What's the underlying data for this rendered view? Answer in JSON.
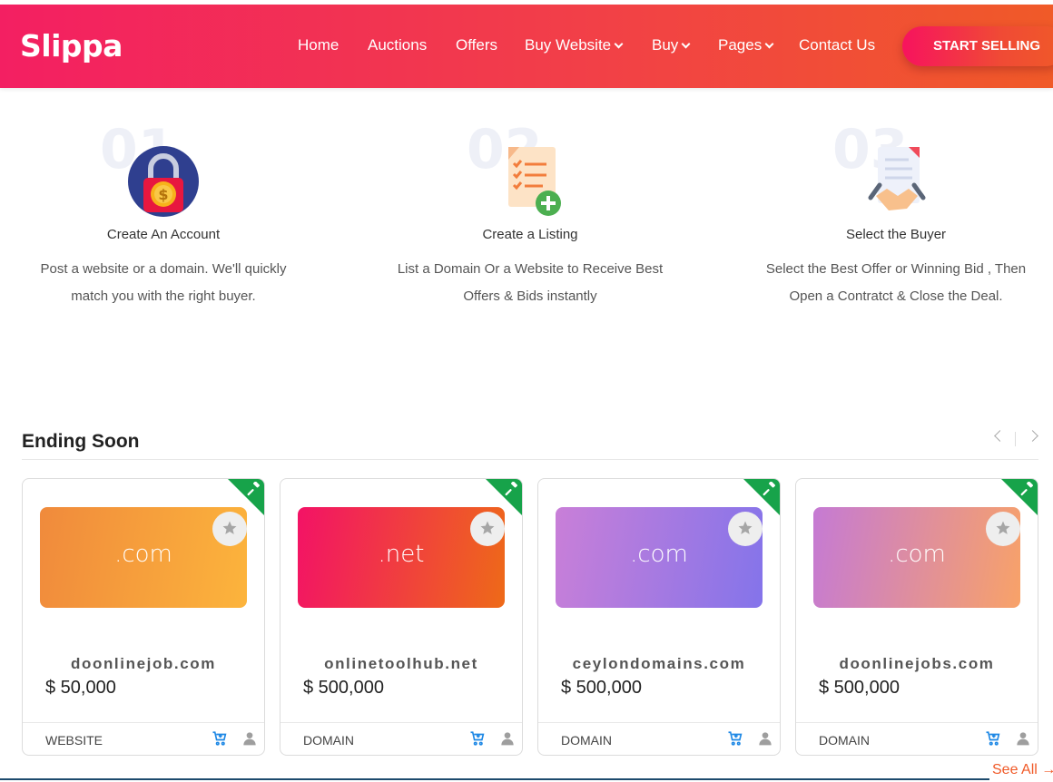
{
  "brand": {
    "name": "Slippa"
  },
  "nav": {
    "items": [
      {
        "label": "Home",
        "dropdown": false
      },
      {
        "label": "Auctions",
        "dropdown": false
      },
      {
        "label": "Offers",
        "dropdown": false
      },
      {
        "label": "Buy Website",
        "dropdown": true
      },
      {
        "label": "Buy",
        "dropdown": true
      },
      {
        "label": "Pages",
        "dropdown": true
      },
      {
        "label": "Contact Us",
        "dropdown": false
      }
    ],
    "cta_label": "START SELLING"
  },
  "steps": [
    {
      "number": "01",
      "icon": "lock-coin-icon",
      "title": "Create An Account",
      "desc_line1": "Post a website or a domain. We'll quickly",
      "desc_line2": "match you with the right buyer."
    },
    {
      "number": "02",
      "icon": "listing-add-icon",
      "title": "Create a Listing",
      "desc_line1": "List a Domain Or a Website to Receive Best",
      "desc_line2": "Offers & Bids instantly"
    },
    {
      "number": "03",
      "icon": "handshake-document-icon",
      "title": "Select the Buyer",
      "desc_line1": "Select the Best Offer or Winning Bid , Then",
      "desc_line2": "Open a Contratct & Close the Deal."
    }
  ],
  "ending_soon": {
    "title": "Ending Soon",
    "see_all": "See All",
    "cards": [
      {
        "extension": ".com",
        "name": "doonlinejob.com",
        "price": "$ 50,000",
        "type": "WEBSITE",
        "gradient_from": "#f08a3c",
        "gradient_to": "#fcb43c"
      },
      {
        "extension": ".net",
        "name": "onlinetoolhub.net",
        "price": "$ 500,000",
        "type": "DOMAIN",
        "gradient_from": "#f31266",
        "gradient_to": "#ee6a18"
      },
      {
        "extension": ".com",
        "name": "ceylondomains.com",
        "price": "$ 500,000",
        "type": "DOMAIN",
        "gradient_from": "#c97fd8",
        "gradient_to": "#8474ea"
      },
      {
        "extension": ".com",
        "name": "doonlinejobs.com",
        "price": "$ 500,000",
        "type": "DOMAIN",
        "gradient_from": "#c57ad4",
        "gradient_to": "#f8a268"
      }
    ]
  },
  "colors": {
    "accent": "#f23f48",
    "ribbon": "#17a34a",
    "icon_blue": "#1e88e5"
  }
}
